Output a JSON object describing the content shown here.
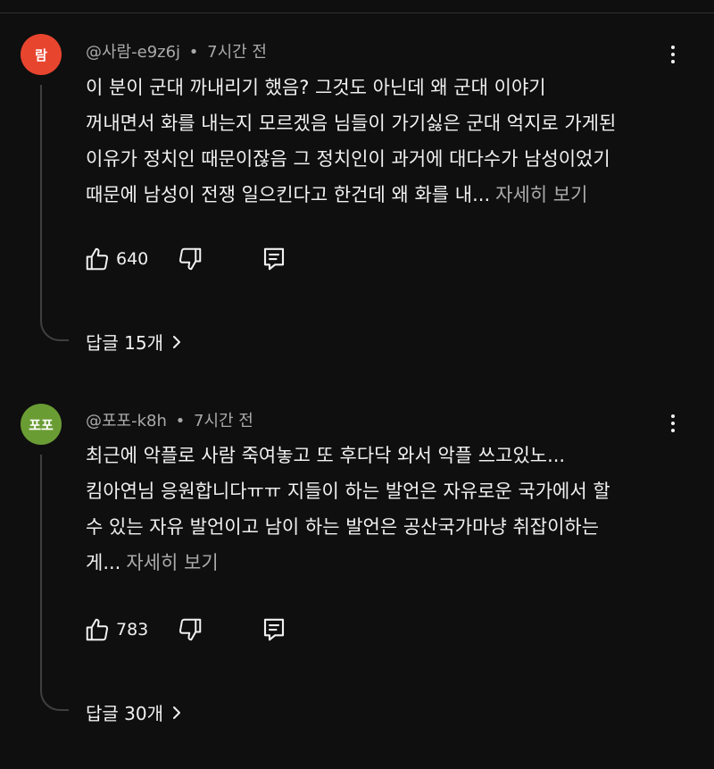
{
  "comments": [
    {
      "avatar_text": "람",
      "avatar_color": "#e8452f",
      "author": "@사람-e9z6j",
      "separator": "•",
      "time": "7시간 전",
      "lines": [
        "이 분이 군대 까내리기 했음? 그것도 아닌데 왜 군대 이야기",
        "꺼내면서 화를 내는지 모르겠음 님들이 가기싫은 군대 억지로 가게된",
        "이유가 정치인 때문이잖음 그 정치인이 과거에 대다수가 남성이었기",
        "때문에 남성이 전쟁 일으킨다고 한건데 왜 화를 내..."
      ],
      "read_more": "자세히 보기",
      "likes": "640",
      "replies_label": "답글 15개"
    },
    {
      "avatar_text": "포포",
      "avatar_color": "#6a9c34",
      "author": "@포포-k8h",
      "separator": "•",
      "time": "7시간 전",
      "lines": [
        "최근에 악플로 사람 죽여놓고 또 후다닥 와서 악플 쓰고있노...",
        "킴아연님 응원합니다ㅠㅠ 지들이 하는 발언은 자유로운 국가에서 할",
        "수 있는 자유 발언이고 남이 하는 발언은 공산국가마냥 취잡이하는",
        "게..."
      ],
      "read_more": "자세히 보기",
      "likes": "783",
      "replies_label": "답글 30개"
    }
  ],
  "icons": {
    "like": "thumbs-up-icon",
    "dislike": "thumbs-down-icon",
    "reply": "comment-reply-icon",
    "more": "more-vertical-icon",
    "chevron": "chevron-right-icon"
  }
}
